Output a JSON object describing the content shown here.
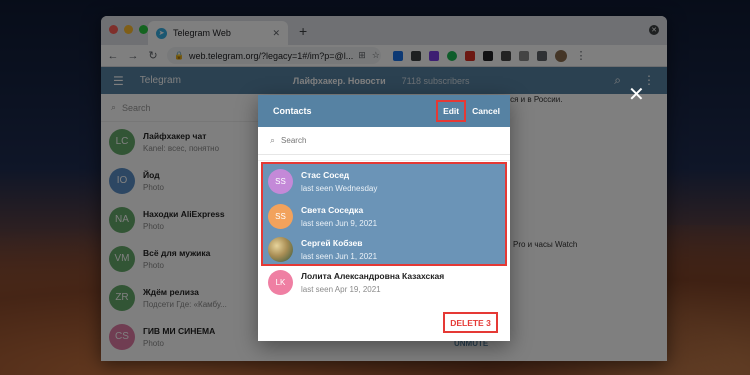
{
  "browser": {
    "tab_title": "Telegram Web",
    "tab_favicon": "telegram-icon",
    "url": "web.telegram.org/?legacy=1#/im?p=@l..."
  },
  "telegram": {
    "app_title": "Telegram",
    "chat_title": "Лайфхакер. Новости",
    "chat_subtitle": "7118 subscribers",
    "search_placeholder": "Search",
    "dialogs": [
      {
        "initials": "LC",
        "name": "Лайфхакер чат",
        "message": "Kanel: всес, понятно",
        "color": "#65aa6a"
      },
      {
        "initials": "IO",
        "name": "Йод",
        "message": "Photo",
        "color": "#5a8fc7"
      },
      {
        "initials": "NA",
        "name": "Находки AliExpress",
        "message": "Photo",
        "color": "#65aa6a"
      },
      {
        "initials": "VM",
        "name": "Всё для мужика",
        "message": "Photo",
        "color": "#65aa6a"
      },
      {
        "initials": "ZR",
        "name": "Ждём релиза",
        "message": "Подсети Где: «Камбу...",
        "color": "#65aa6a"
      },
      {
        "initials": "CS",
        "name": "ГИВ МИ СИНЕМА",
        "message": "Photo",
        "color": "#e07aa4"
      }
    ],
    "chat_snippets": {
      "line1": "оться и в России.",
      "line2": "Pro и часы Watch",
      "line3": "UNMUTE"
    }
  },
  "modal": {
    "title": "Contacts",
    "edit_label": "Edit",
    "cancel_label": "Cancel",
    "search_placeholder": "Search",
    "contacts": [
      {
        "initials": "SS",
        "name": "Стас Сосед",
        "status": "last seen Wednesday",
        "selected": true,
        "color": "#c489d8"
      },
      {
        "initials": "SS",
        "name": "Света Соседка",
        "status": "last seen Jun 9, 2021",
        "selected": true,
        "color": "#f2a25c"
      },
      {
        "initials": "",
        "name": "Сергей Кобзев",
        "status": "last seen Jun 1, 2021",
        "selected": true,
        "color": ""
      },
      {
        "initials": "LK",
        "name": "Лолита Александровна Казахская",
        "status": "last seen Apr 19, 2021",
        "selected": false,
        "color": "#ef7fa3"
      }
    ],
    "delete_label": "DELETE 3",
    "close_icon": "close-icon"
  },
  "colors": {
    "accent": "#5682a3",
    "selection": "#6b94b7",
    "highlight_border": "#e53935"
  }
}
